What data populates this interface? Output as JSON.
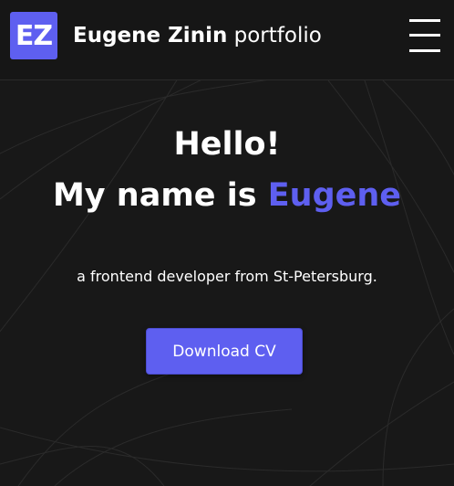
{
  "header": {
    "logo_text": "EZ",
    "brand_name": "Eugene Zinin",
    "brand_sub": "portfolio",
    "menu_icon": "hamburger-menu-icon"
  },
  "hero": {
    "greeting": "Hello!",
    "intro_prefix": "My name is ",
    "intro_name": "Eugene",
    "tagline": "a frontend developer from St-Petersburg.",
    "cv_button_label": "Download CV"
  },
  "colors": {
    "background": "#181818",
    "accent": "#5e5ff0",
    "text": "#ffffff"
  }
}
